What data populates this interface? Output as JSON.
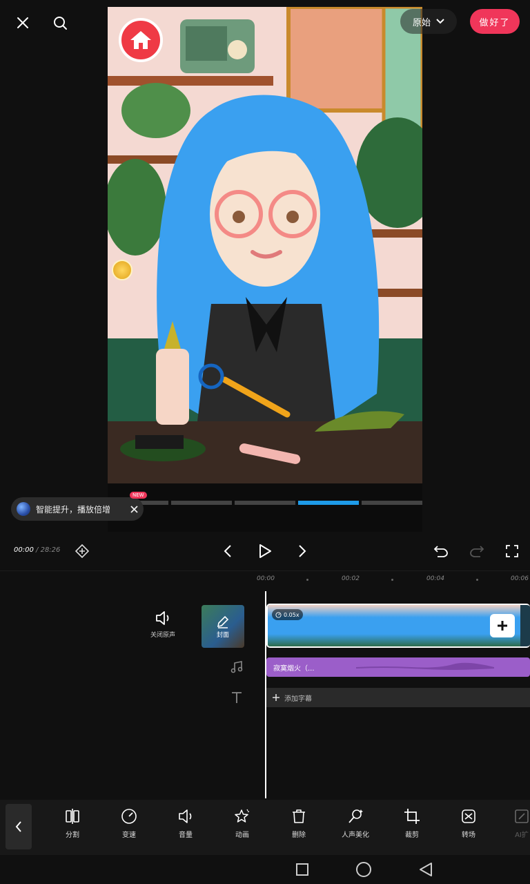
{
  "header": {
    "ratio_label": "原始",
    "done_label": "做好了"
  },
  "icons": {
    "close": "close-icon",
    "search": "search-icon",
    "home": "home-icon"
  },
  "tip": {
    "text": "智能提升，播放倍增",
    "badge": "NEW"
  },
  "player": {
    "current_time": "00:00",
    "separator": "/",
    "total_time": "28:26"
  },
  "ruler": {
    "labels": [
      "00:00",
      "00:02",
      "00:04",
      "00:06"
    ]
  },
  "tracks": {
    "mute_label": "关闭原声",
    "cover_label": "封面",
    "speed": "0.05x",
    "music_title": "寂寞烟火（...",
    "add_subtitle": "添加字幕"
  },
  "toolbar": {
    "items": [
      {
        "label": "分割",
        "icon": "split-icon"
      },
      {
        "label": "变速",
        "icon": "speed-icon"
      },
      {
        "label": "音量",
        "icon": "volume-icon"
      },
      {
        "label": "动画",
        "icon": "animation-icon"
      },
      {
        "label": "删除",
        "icon": "delete-icon"
      },
      {
        "label": "人声美化",
        "icon": "voice-beautify-icon"
      },
      {
        "label": "裁剪",
        "icon": "crop-icon"
      },
      {
        "label": "转场",
        "icon": "transition-icon"
      },
      {
        "label": "AI扩",
        "icon": "ai-expand-icon"
      }
    ]
  },
  "colors": {
    "accent": "#f0365a",
    "music": "#9b5ec9",
    "progress_active": "#1e9be8"
  }
}
